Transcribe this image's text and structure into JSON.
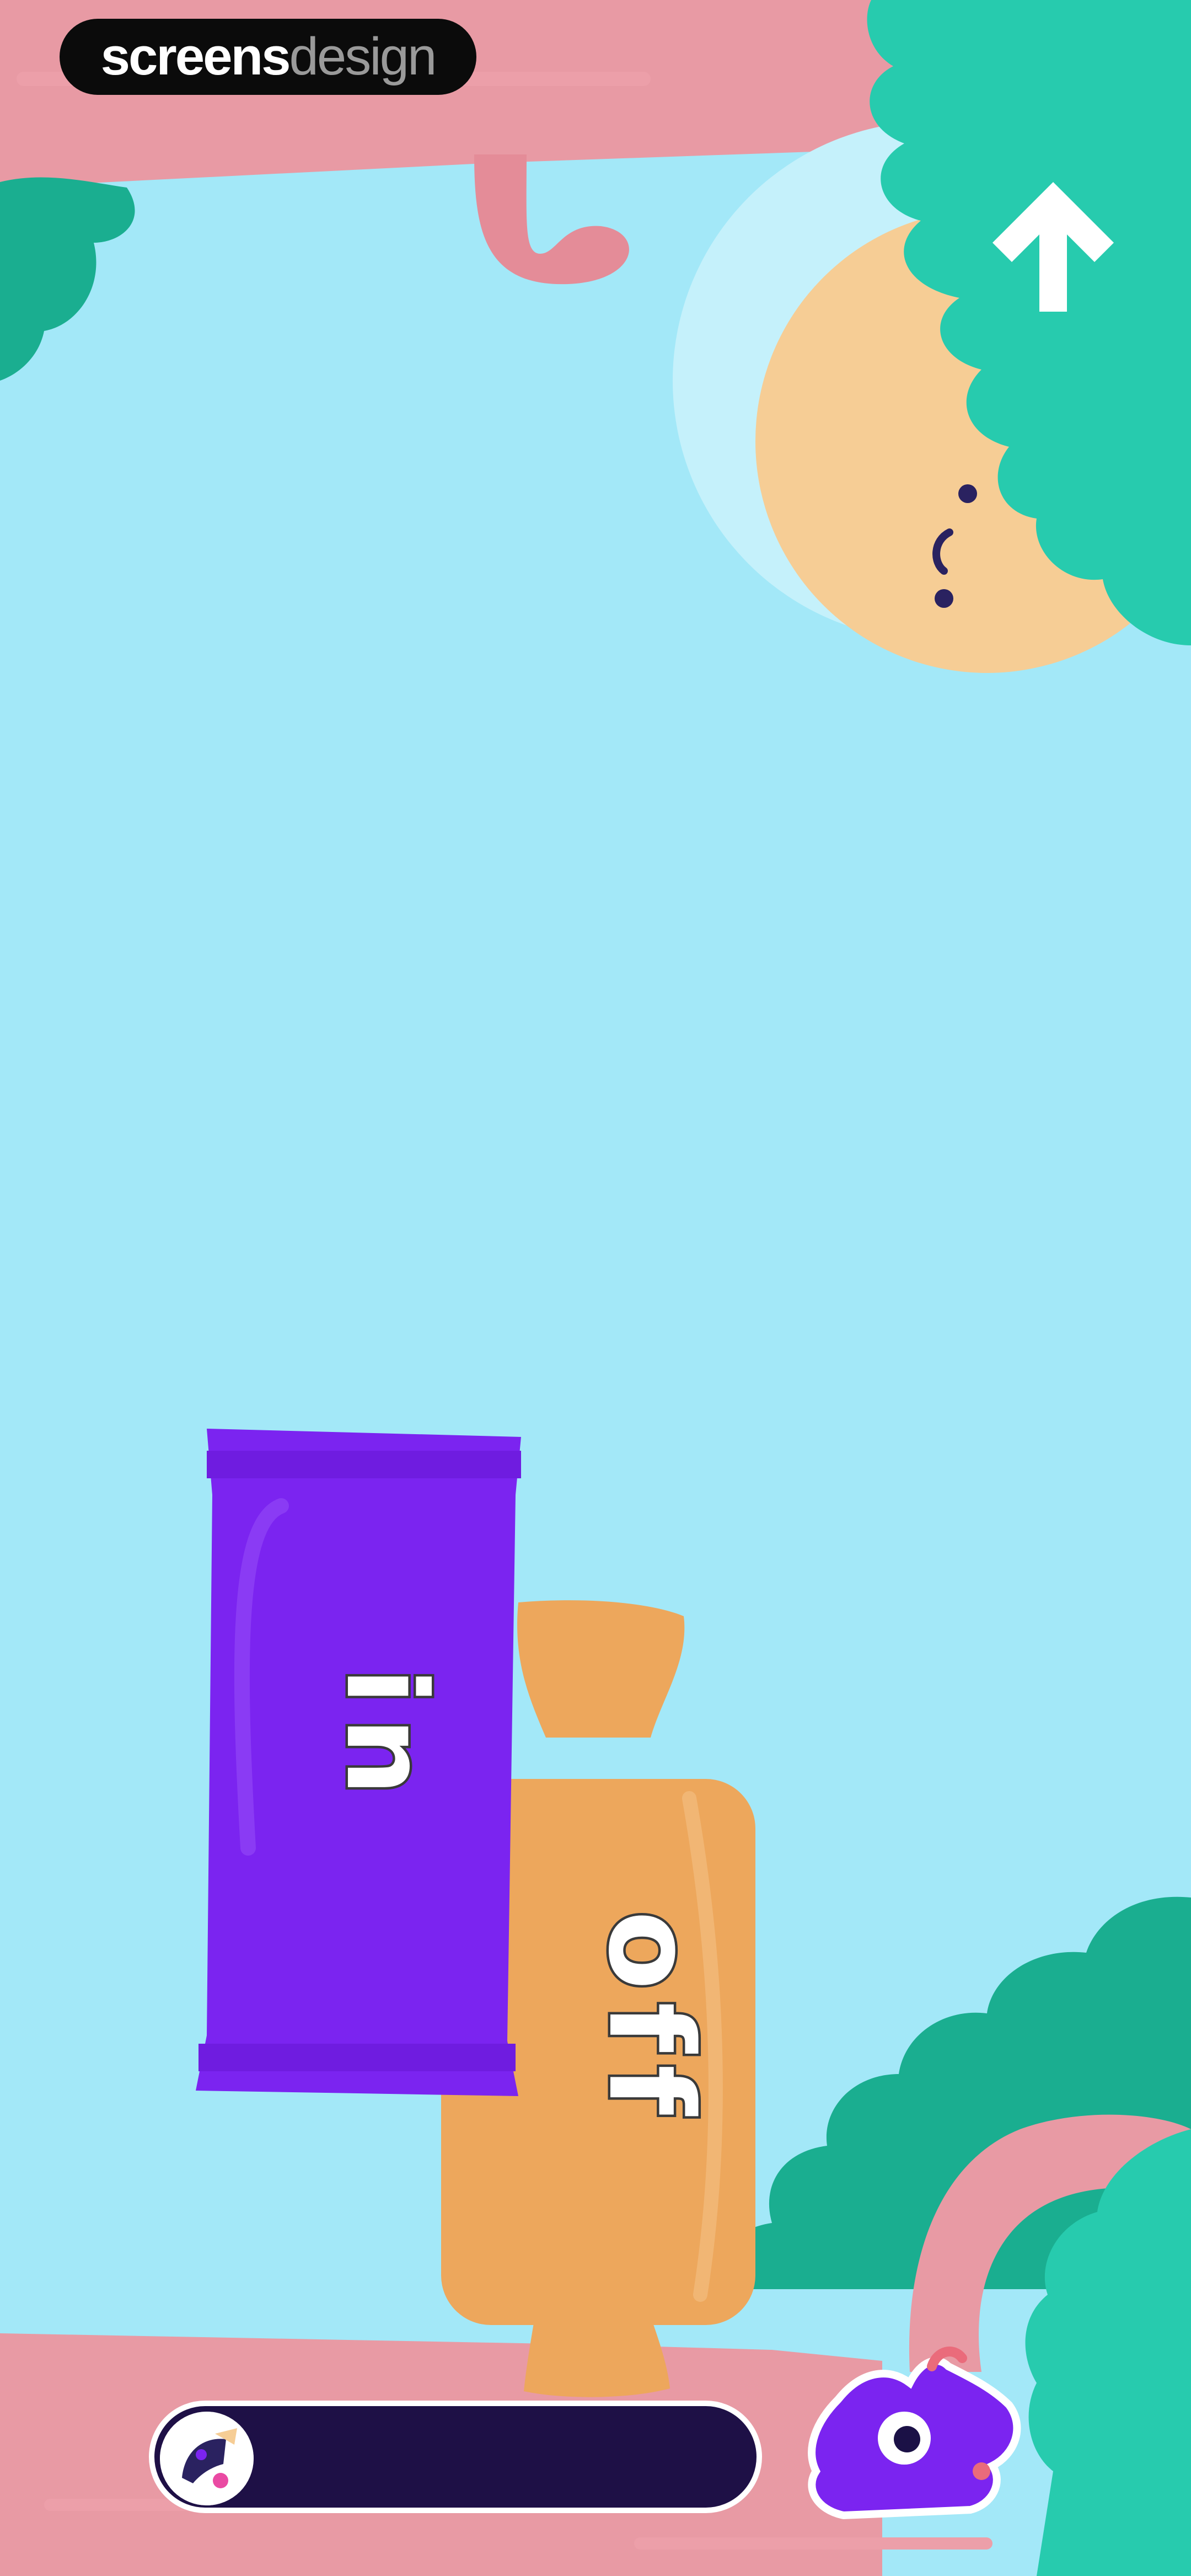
{
  "branding": {
    "badge_bold": "screens",
    "badge_light": "design"
  },
  "words": {
    "in": "in",
    "off": "off"
  },
  "game": {
    "progress": 0.0
  },
  "icons": {
    "top_right": "up-arrow-icon",
    "progress_avatar": "character-avatar-icon",
    "bottom_right": "purple-monster-icon"
  },
  "colors": {
    "sky": "#a3e8f8",
    "branch": "#e89aa4",
    "leaves": "#27cbae",
    "leaves_dark": "#1aae90",
    "moon": "#f6cd95",
    "moon_glow": "#c5f1fb",
    "card_in": "#7b24f0",
    "candy_off": "#eda75c",
    "progress_track": "#1e1046"
  }
}
